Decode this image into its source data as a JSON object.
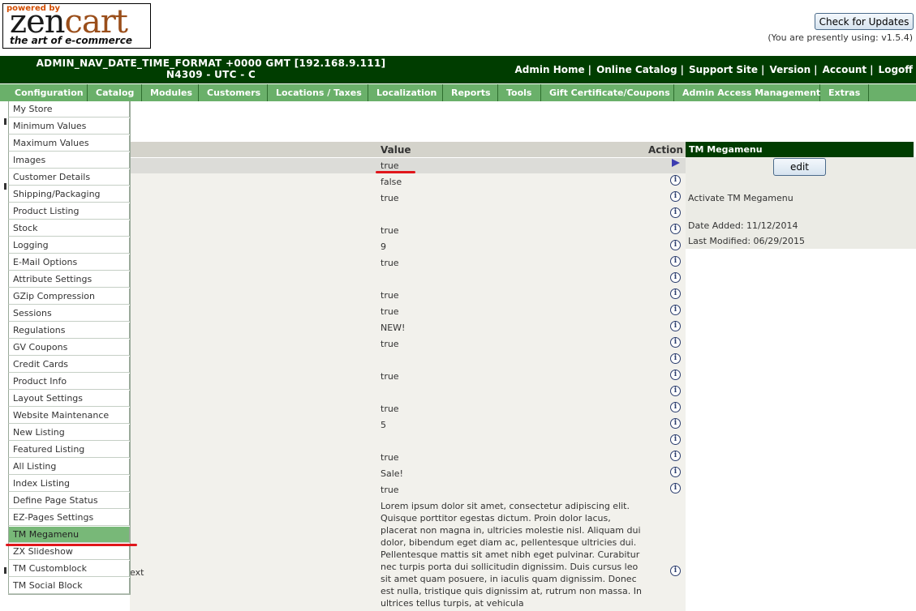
{
  "logo": {
    "powered_by": "powered by",
    "brand_zen": "zen",
    "brand_cart": "cart",
    "tagline": "the art of e-commerce"
  },
  "updates": {
    "button_label": "Check for Updates",
    "version_note": "(You are presently using: v1.5.4)"
  },
  "header": {
    "date_line1": "ADMIN_NAV_DATE_TIME_FORMAT +0000 GMT [192.168.9.111]",
    "date_line2": "N4309 - UTC - C",
    "links": [
      "Admin Home",
      "Online Catalog",
      "Support Site",
      "Version",
      "Account",
      "Logoff"
    ],
    "separator": "|"
  },
  "menu": {
    "items": [
      "Configuration",
      "Catalog",
      "Modules",
      "Customers",
      "Locations / Taxes",
      "Localization",
      "Reports",
      "Tools",
      "Gift Certificate/Coupons",
      "Admin Access Management",
      "Extras"
    ]
  },
  "dropdown": {
    "items": [
      "My Store",
      "Minimum Values",
      "Maximum Values",
      "Images",
      "Customer Details",
      "Shipping/Packaging",
      "Product Listing",
      "Stock",
      "Logging",
      "E-Mail Options",
      "Attribute Settings",
      "GZip Compression",
      "Sessions",
      "Regulations",
      "GV Coupons",
      "Credit Cards",
      "Product Info",
      "Layout Settings",
      "Website Maintenance",
      "New Listing",
      "Featured Listing",
      "All Listing",
      "Index Listing",
      "Define Page Status",
      "EZ-Pages Settings",
      "TM Megamenu",
      "ZX Slideshow",
      "TM Customblock",
      "TM Social Block"
    ],
    "active": "TM Megamenu"
  },
  "table": {
    "col_value": "Value",
    "col_action": "Action",
    "values": [
      "true",
      "false",
      "true",
      "",
      "true",
      "9",
      "true",
      "",
      "true",
      "true",
      "NEW!",
      "true",
      "",
      "true",
      "",
      "true",
      "5",
      "",
      "true",
      "Sale!",
      "true"
    ],
    "long_text": "Lorem ipsum dolor sit amet, consectetur adipiscing elit. Quisque porttitor egestas dictum. Proin dolor lacus, placerat non magna in, ultricies molestie nisl. Aliquam dui dolor, bibendum eget diam ac, pellentesque ultricies dui. Pellentesque mattis sit amet nibh eget pulvinar. Curabitur nec turpis porta dui sollicitudin dignissim. Duis cursus leo sit amet quam posuere, in iaculis quam dignissim. Donec est nulla, tristique quis dignissim at, rutrum non massa. In ultrices tellus turpis, at vehicula",
    "left_fragment": "ext"
  },
  "info_box": {
    "title": "TM Megamenu",
    "edit_label": "edit",
    "description": "Activate TM Megamenu",
    "date_added": "Date Added: 11/12/2014",
    "last_modified": "Last Modified: 06/29/2015"
  },
  "colors": {
    "dark_green": "#003d00",
    "menu_green": "#6ab06a",
    "highlight_red": "#e0161b"
  }
}
